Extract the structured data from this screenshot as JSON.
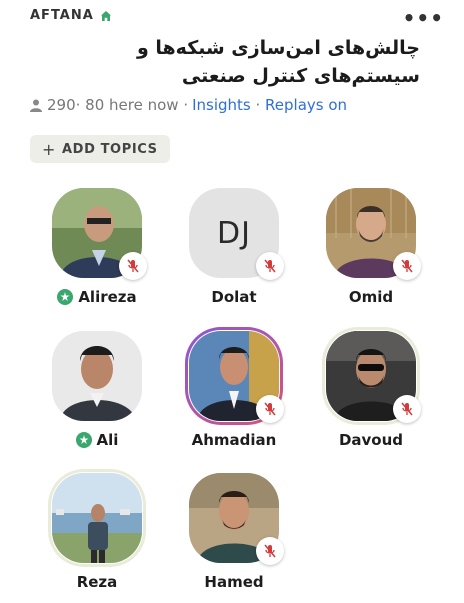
{
  "header": {
    "club_name": "AFTANA",
    "more_label": "•••"
  },
  "room": {
    "title": "چالش‌های امن‌سازی شبکه‌ها و سیستم‌های کنترل صنعتی",
    "listeners": "290",
    "here_now": "· 80 here now ·",
    "insights_label": "Insights",
    "separator": " · ",
    "replays_label": "Replays on"
  },
  "topics": {
    "add_label": "ADD TOPICS"
  },
  "speakers": [
    {
      "name": "Alireza",
      "moderator": true,
      "muted": true
    },
    {
      "name": "Dolat",
      "initials": "DJ",
      "moderator": false,
      "muted": true
    },
    {
      "name": "Omid",
      "moderator": false,
      "muted": true
    },
    {
      "name": "Ali",
      "moderator": true,
      "muted": false
    },
    {
      "name": "Ahmadian",
      "moderator": false,
      "muted": true
    },
    {
      "name": "Davoud",
      "moderator": false,
      "muted": true
    },
    {
      "name": "Reza",
      "moderator": false,
      "muted": false
    },
    {
      "name": "Hamed",
      "moderator": false,
      "muted": true
    }
  ],
  "colors": {
    "accent": "#2f6fd6",
    "moderator_green": "#3aa76d",
    "mute_red": "#d33a3a",
    "home_green": "#3aa76d"
  }
}
